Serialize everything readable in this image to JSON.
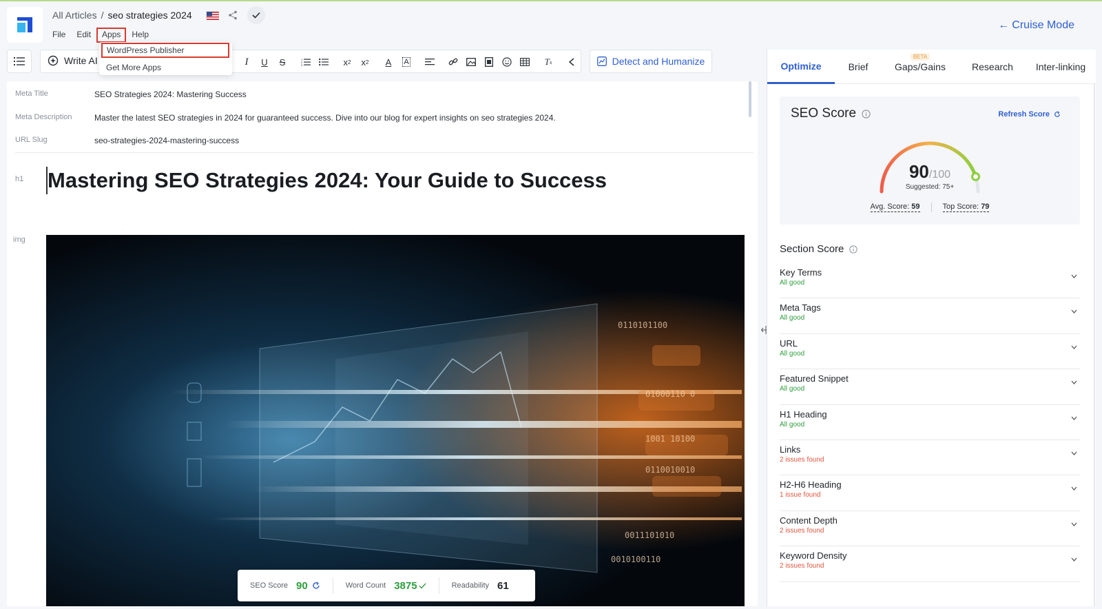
{
  "header": {
    "breadcrumb_root": "All Articles",
    "breadcrumb_sep": "/",
    "breadcrumb_current": "seo strategies 2024",
    "cruise_mode": "Cruise Mode",
    "cruise_arrow": "←"
  },
  "menubar": {
    "file": "File",
    "edit": "Edit",
    "apps": "Apps",
    "help": "Help"
  },
  "apps_menu": {
    "items": [
      "WordPress Publisher",
      "Get More Apps"
    ]
  },
  "toolbar": {
    "write_ai": "Write AI",
    "detect_humanize": "Detect and Humanize",
    "tools": [
      "I",
      "U",
      "S",
      "ordered-list",
      "bullet-list",
      "subscript",
      "superscript",
      "text-color",
      "highlight",
      "align",
      "link",
      "image",
      "video",
      "emoji",
      "table",
      "clear-format",
      "collapse"
    ]
  },
  "meta": {
    "title_label": "Meta Title",
    "title_value": "SEO Strategies 2024: Mastering Success",
    "desc_label": "Meta Description",
    "desc_value": "Master the latest SEO strategies in 2024 for guaranteed success. Dive into our blog for expert insights on seo strategies 2024.",
    "slug_label": "URL Slug",
    "slug_value": "seo-strategies-2024-mastering-success"
  },
  "content": {
    "h1_label": "h1",
    "h1_text": "Mastering SEO Strategies 2024: Your Guide to Success",
    "img_label": "img"
  },
  "stats": {
    "seo_label": "SEO Score",
    "seo_value": "90",
    "wc_label": "Word Count",
    "wc_value": "3875",
    "read_label": "Readability",
    "read_value": "61"
  },
  "panel": {
    "tabs": [
      {
        "label": "Optimize",
        "active": true
      },
      {
        "label": "Brief",
        "active": false
      },
      {
        "label": "Gaps/Gains",
        "active": false,
        "badge": "BETA"
      },
      {
        "label": "Research",
        "active": false
      },
      {
        "label": "Inter-linking",
        "active": false
      }
    ],
    "seo_score_title": "SEO Score",
    "refresh_label": "Refresh Score",
    "score": "90",
    "score_max": "/100",
    "score_fraction": 0.9,
    "suggested": "Suggested: 75+",
    "avg_label": "Avg. Score:",
    "avg_value": "59",
    "top_label": "Top Score:",
    "top_value": "79",
    "section_title": "Section Score",
    "sections": [
      {
        "name": "Key Terms",
        "status": "All good",
        "state": "good"
      },
      {
        "name": "Meta Tags",
        "status": "All good",
        "state": "good"
      },
      {
        "name": "URL",
        "status": "All good",
        "state": "good"
      },
      {
        "name": "Featured Snippet",
        "status": "All good",
        "state": "good"
      },
      {
        "name": "H1 Heading",
        "status": "All good",
        "state": "good"
      },
      {
        "name": "Links",
        "status": "2 issues found",
        "state": "bad"
      },
      {
        "name": "H2-H6 Heading",
        "status": "1 issue found",
        "state": "bad"
      },
      {
        "name": "Content Depth",
        "status": "2 issues found",
        "state": "bad"
      },
      {
        "name": "Keyword Density",
        "status": "2 issues found",
        "state": "bad"
      }
    ]
  },
  "colors": {
    "accent": "#2f5fd0",
    "good": "#2e9e3c",
    "bad": "#e2553d",
    "highlight_box": "#d63a2f"
  }
}
